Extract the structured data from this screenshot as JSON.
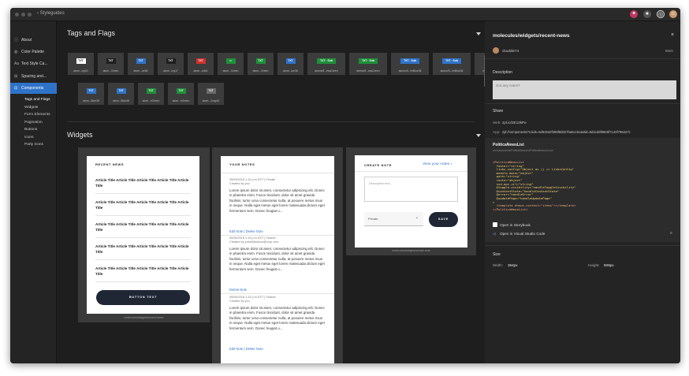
{
  "window": {
    "breadcrumb": "Styleguides",
    "accent": "#2f73c9"
  },
  "sidebar": {
    "items": [
      {
        "label": "About",
        "icon": "info-icon",
        "glyph": "ⓘ"
      },
      {
        "label": "Color Palette",
        "icon": "palette-icon",
        "glyph": "◍"
      },
      {
        "label": "Text Style Ca...",
        "icon": "text-icon",
        "glyph": "Aa"
      },
      {
        "label": "Spacing and...",
        "icon": "spacing-icon",
        "glyph": "⊞"
      },
      {
        "label": "Components",
        "icon": "components-icon",
        "glyph": "⊡"
      }
    ],
    "subitems": [
      "Tags and Flags",
      "Widgets",
      "Form Elements",
      "Pagination",
      "Buttons",
      "Icons",
      "Party Icons"
    ]
  },
  "tags_section": {
    "title": "Tags and Flags",
    "tiles": [
      {
        "name": "atom...ray01",
        "badge": "TXT",
        "color": "#ffffff",
        "text_color": "#222222"
      },
      {
        "name": "atom...Green",
        "badge": "TXT",
        "color": "#1f1f1f",
        "text_color": "#ffffff"
      },
      {
        "name": "atom...ue38",
        "badge": "TXT",
        "color": "#2f73c9",
        "text_color": "#ffffff"
      },
      {
        "name": "atom...ray17",
        "badge": "TXT",
        "color": "#1f1f1f",
        "text_color": "#ffffff"
      },
      {
        "name": "atom...ed44",
        "badge": "TXT",
        "color": "#d0312d",
        "text_color": "#ffffff"
      },
      {
        "name": "atom...Green",
        "badge": "◘",
        "color": "#1f8f3a",
        "text_color": "#ffffff"
      },
      {
        "name": "atom...Green",
        "badge": "TXT",
        "color": "#1f8f3a",
        "text_color": "#ffffff"
      },
      {
        "name": "atom...lue38",
        "badge": "TXT",
        "color": "#2f73c9",
        "text_color": "#ffffff"
      },
      {
        "name": "atoms/fl...essGreen",
        "badge": "TXT · Sub",
        "color": "#1f8f3a",
        "text_color": "#ffffff",
        "wide": true
      },
      {
        "name": "atoms/fl...essGreen",
        "badge": "TXT · Sub",
        "color": "#1f8f3a",
        "text_color": "#ffffff",
        "wide": true
      },
      {
        "name": "atoms/fl...imBlue38",
        "badge": "TXT · Sub",
        "color": "#2f73c9",
        "text_color": "#ffffff",
        "wide": true
      },
      {
        "name": "atoms/fl...imBlue38",
        "badge": "TXT · Sub",
        "color": "#2f73c9",
        "text_color": "#ffffff",
        "wide": true
      },
      {
        "name": "atoms...anGray43",
        "badge": "TXT · Sub",
        "color": "#6a6a6a",
        "text_color": "#ffffff",
        "wide": true
      },
      {
        "name": "atom...Blue38",
        "badge": "TXT",
        "color": "#2f73c9",
        "text_color": "#ffffff"
      },
      {
        "name": "atom...Blue38",
        "badge": "TXT",
        "color": "#2f73c9",
        "text_color": "#ffffff"
      },
      {
        "name": "atom...eGreen",
        "badge": "TXT",
        "color": "#1f8f3a",
        "text_color": "#ffffff"
      },
      {
        "name": "atom...eGreen",
        "badge": "TXT",
        "color": "#1f8f3a",
        "text_color": "#ffffff"
      },
      {
        "name": "atom...Gray43",
        "badge": "TXT",
        "color": "#6a6a6a",
        "text_color": "#ffffff"
      }
    ]
  },
  "widgets_section": {
    "title": "Widgets",
    "recent_news": {
      "heading": "RECENT NEWS",
      "articles": [
        "Article Title Article Title Article Title Article Title Article Title",
        "Article Title Article Title Article Title Article Title Article Title",
        "Article Title Article Title Article Title Article Title Article Title",
        "Article Title Article Title Article Title Article Title Article Title",
        "Article Title Article Title Article Title Article Title Article Title"
      ],
      "button": "BUTTON TEXT",
      "caption": "molecules/widgets/recent-news"
    },
    "your_notes": {
      "heading": "YOUR NOTES",
      "notes": [
        {
          "meta1": "05/05/2018 1:15 p.m EST | Private",
          "meta2": "Created by you",
          "body": "Lorem ipsum dolor sit amet, consectetur adipiscing elit. Donec in pharetra enim. Fusce tincidunt, dolor sit amet gravida facilisis, tortor urna consectetur nulla, at posuere metus risus in neque. Nulla eget metus eget lorem malesuada dictum eget fermentum sem. Donec feugiat u...",
          "edit": "Edit Note",
          "delete": "Delete Note"
        },
        {
          "meta1": "05/05/2018 1:15 p.m EST | Shared",
          "meta2": "Created by jmcwilliamson@corp.com",
          "body": "Lorem ipsum dolor sit amet, consectetur adipiscing elit. Donec in pharetra enim. Fusce tincidunt, dolor sit amet gravida facilisis, tortor urna consectetur nulla, at posuere metus risus in neque. Nulla eget metus eget lorem malesuada dictum eget fermentum sem. Donec feugiat u...",
          "delete": "Delete Note"
        },
        {
          "meta1": "05/05/2018 1:15 p.m EST | Shared",
          "meta2": "Created by you",
          "body": "Lorem ipsum dolor sit amet, consectetur adipiscing elit. Donec in pharetra enim. Fusce tincidunt, dolor sit amet gravida facilisis, tortor urna consectetur nulla, at posuere metus risus in neque. Nulla eget metus eget lorem malesuada dictum eget fermentum sem. Donec feugiat u...",
          "edit": "Edit Note",
          "delete": "Delete Note"
        }
      ]
    },
    "create_note": {
      "heading": "CREATE NOTE",
      "view_link": "View your notes",
      "placeholder": "Description text...",
      "select_value": "Private",
      "save": "SAVE",
      "caption": "molecules/widgets/create-note"
    }
  },
  "panel": {
    "title": "molecules/widgets/recent-news",
    "user": "cbuddie74",
    "time": "8min",
    "description_label": "Description",
    "notes_placeholder": "Got any notes?",
    "share_label": "Share",
    "web_label": "Web:",
    "web_value": "zpl.io/2E13kPe",
    "app_label": "App:",
    "app_value": "zpl://components?coids=5d92532f385f8d027ba0cc6c&stid=5d2cd9f6856f7142f796427c",
    "component_name": "PoliticaNewsList",
    "component_path": "src/components/PoliticaNewsList/PoliticaNewsList.vue",
    "code_lines": [
      "<PoliticaNewsList",
      "  footer=\"string\"",
      "  links-config=\"Object as () => LinksConfig\"",
      "  module-data=\"object\"",
      "  path=\"string\"",
      "  route=\"object\"",
      "  ssd-api-url=\"string\"",
      "  @toggle-visibility=\"handleToggleVisibility\"",
      "  @contentState=\"handleContentState\"",
      "  @error=\"handleError\"",
      "  @updatePage=\"handleUpdatePage\"",
      ">",
      "  <template #news-content=\"items\"></template>",
      "</PoliticaNewsList>"
    ],
    "open_storybook": "Open in Storybook",
    "open_vscode": "Open in Visual Studio Code",
    "size_label": "Size",
    "width_label": "Width:",
    "width_value": "364px",
    "height_label": "Height:",
    "height_value": "509px"
  }
}
